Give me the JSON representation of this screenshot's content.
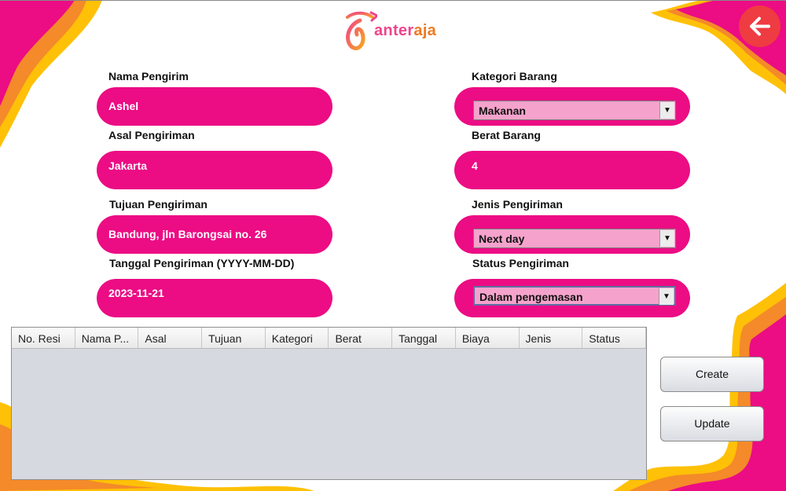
{
  "app": {
    "logo": {
      "prefix": "anter",
      "suffix": "aja"
    },
    "back_icon": "arrow-left-icon"
  },
  "form": {
    "nama_pengirim": {
      "label": "Nama Pengirim",
      "value": "Ashel"
    },
    "asal_pengiriman": {
      "label": "Asal Pengiriman",
      "value": "Jakarta"
    },
    "tujuan_pengiriman": {
      "label": "Tujuan Pengiriman",
      "value": "Bandung, jln Barongsai no. 26"
    },
    "tanggal_pengiriman": {
      "label": "Tanggal Pengiriman (YYYY-MM-DD)",
      "value": "2023-11-21"
    },
    "kategori_barang": {
      "label": "Kategori Barang",
      "selected": "Makanan"
    },
    "berat_barang": {
      "label": "Berat Barang",
      "value": "4"
    },
    "jenis_pengiriman": {
      "label": "Jenis Pengiriman",
      "selected": "Next day"
    },
    "status_pengiriman": {
      "label": "Status Pengiriman",
      "selected": "Dalam pengemasan"
    }
  },
  "table": {
    "columns": [
      "No. Resi",
      "Nama P...",
      "Asal",
      "Tujuan",
      "Kategori",
      "Berat",
      "Tanggal",
      "Biaya",
      "Jenis",
      "Status"
    ],
    "rows": []
  },
  "buttons": {
    "create": "Create",
    "update": "Update"
  },
  "colors": {
    "accent_pink": "#ec0c84",
    "combo_pink": "#f5a3cc",
    "orange": "#f48a29",
    "yellow": "#ffc107",
    "back_red": "#ef3b42"
  }
}
